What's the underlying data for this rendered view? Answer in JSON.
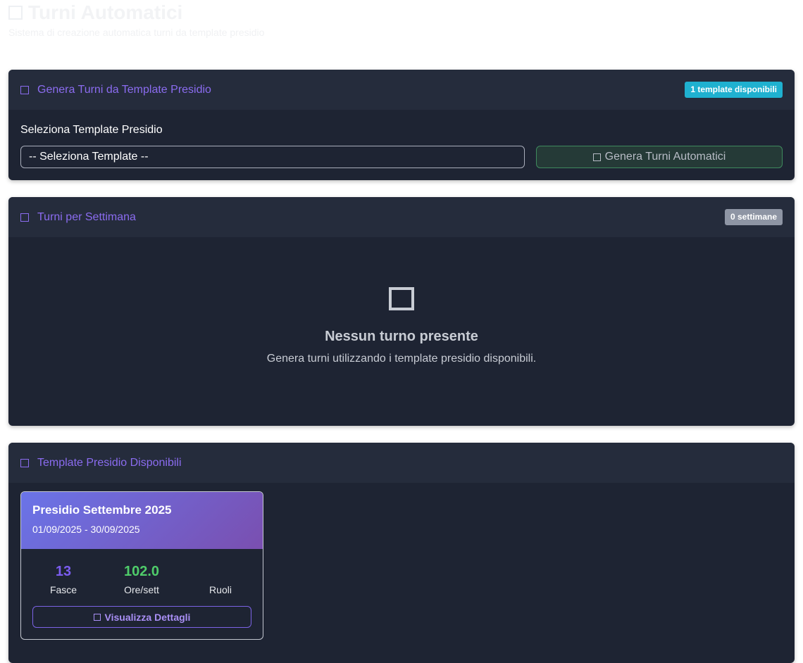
{
  "page": {
    "title": "Turni Automatici",
    "subtitle": "Sistema di creazione automatica turni da template presidio"
  },
  "generate": {
    "title": "Genera Turni da Template Presidio",
    "badge": "1 template disponibili",
    "badge_color": "#1fb1d0",
    "label": "Seleziona Template Presidio",
    "select_value": "-- Seleziona Template --",
    "button_label": "Genera Turni Automatici"
  },
  "weeks": {
    "title": "Turni per Settimana",
    "badge": "0 settimane",
    "badge_color": "#8e95a4",
    "empty_title": "Nessun turno presente",
    "empty_text": "Genera turni utilizzando i template presidio disponibili."
  },
  "templates": {
    "title": "Template Presidio Disponibili",
    "items": [
      {
        "name": "Presidio Settembre 2025",
        "dates": "01/09/2025 - 30/09/2025",
        "stats": [
          {
            "value": "13",
            "label": "Fasce",
            "color": "#7b5cf0"
          },
          {
            "value": "102.0",
            "label": "Ore/sett",
            "color": "#4fcc6a"
          },
          {
            "value": "",
            "label": "Ruoli",
            "color": "#1fb1d0"
          }
        ],
        "button_label": "Visualizza Dettagli"
      }
    ]
  },
  "colors": {
    "accent": "#8b6cf0",
    "card_bg": "#1e2433",
    "card_header_bg": "#252c3c"
  }
}
